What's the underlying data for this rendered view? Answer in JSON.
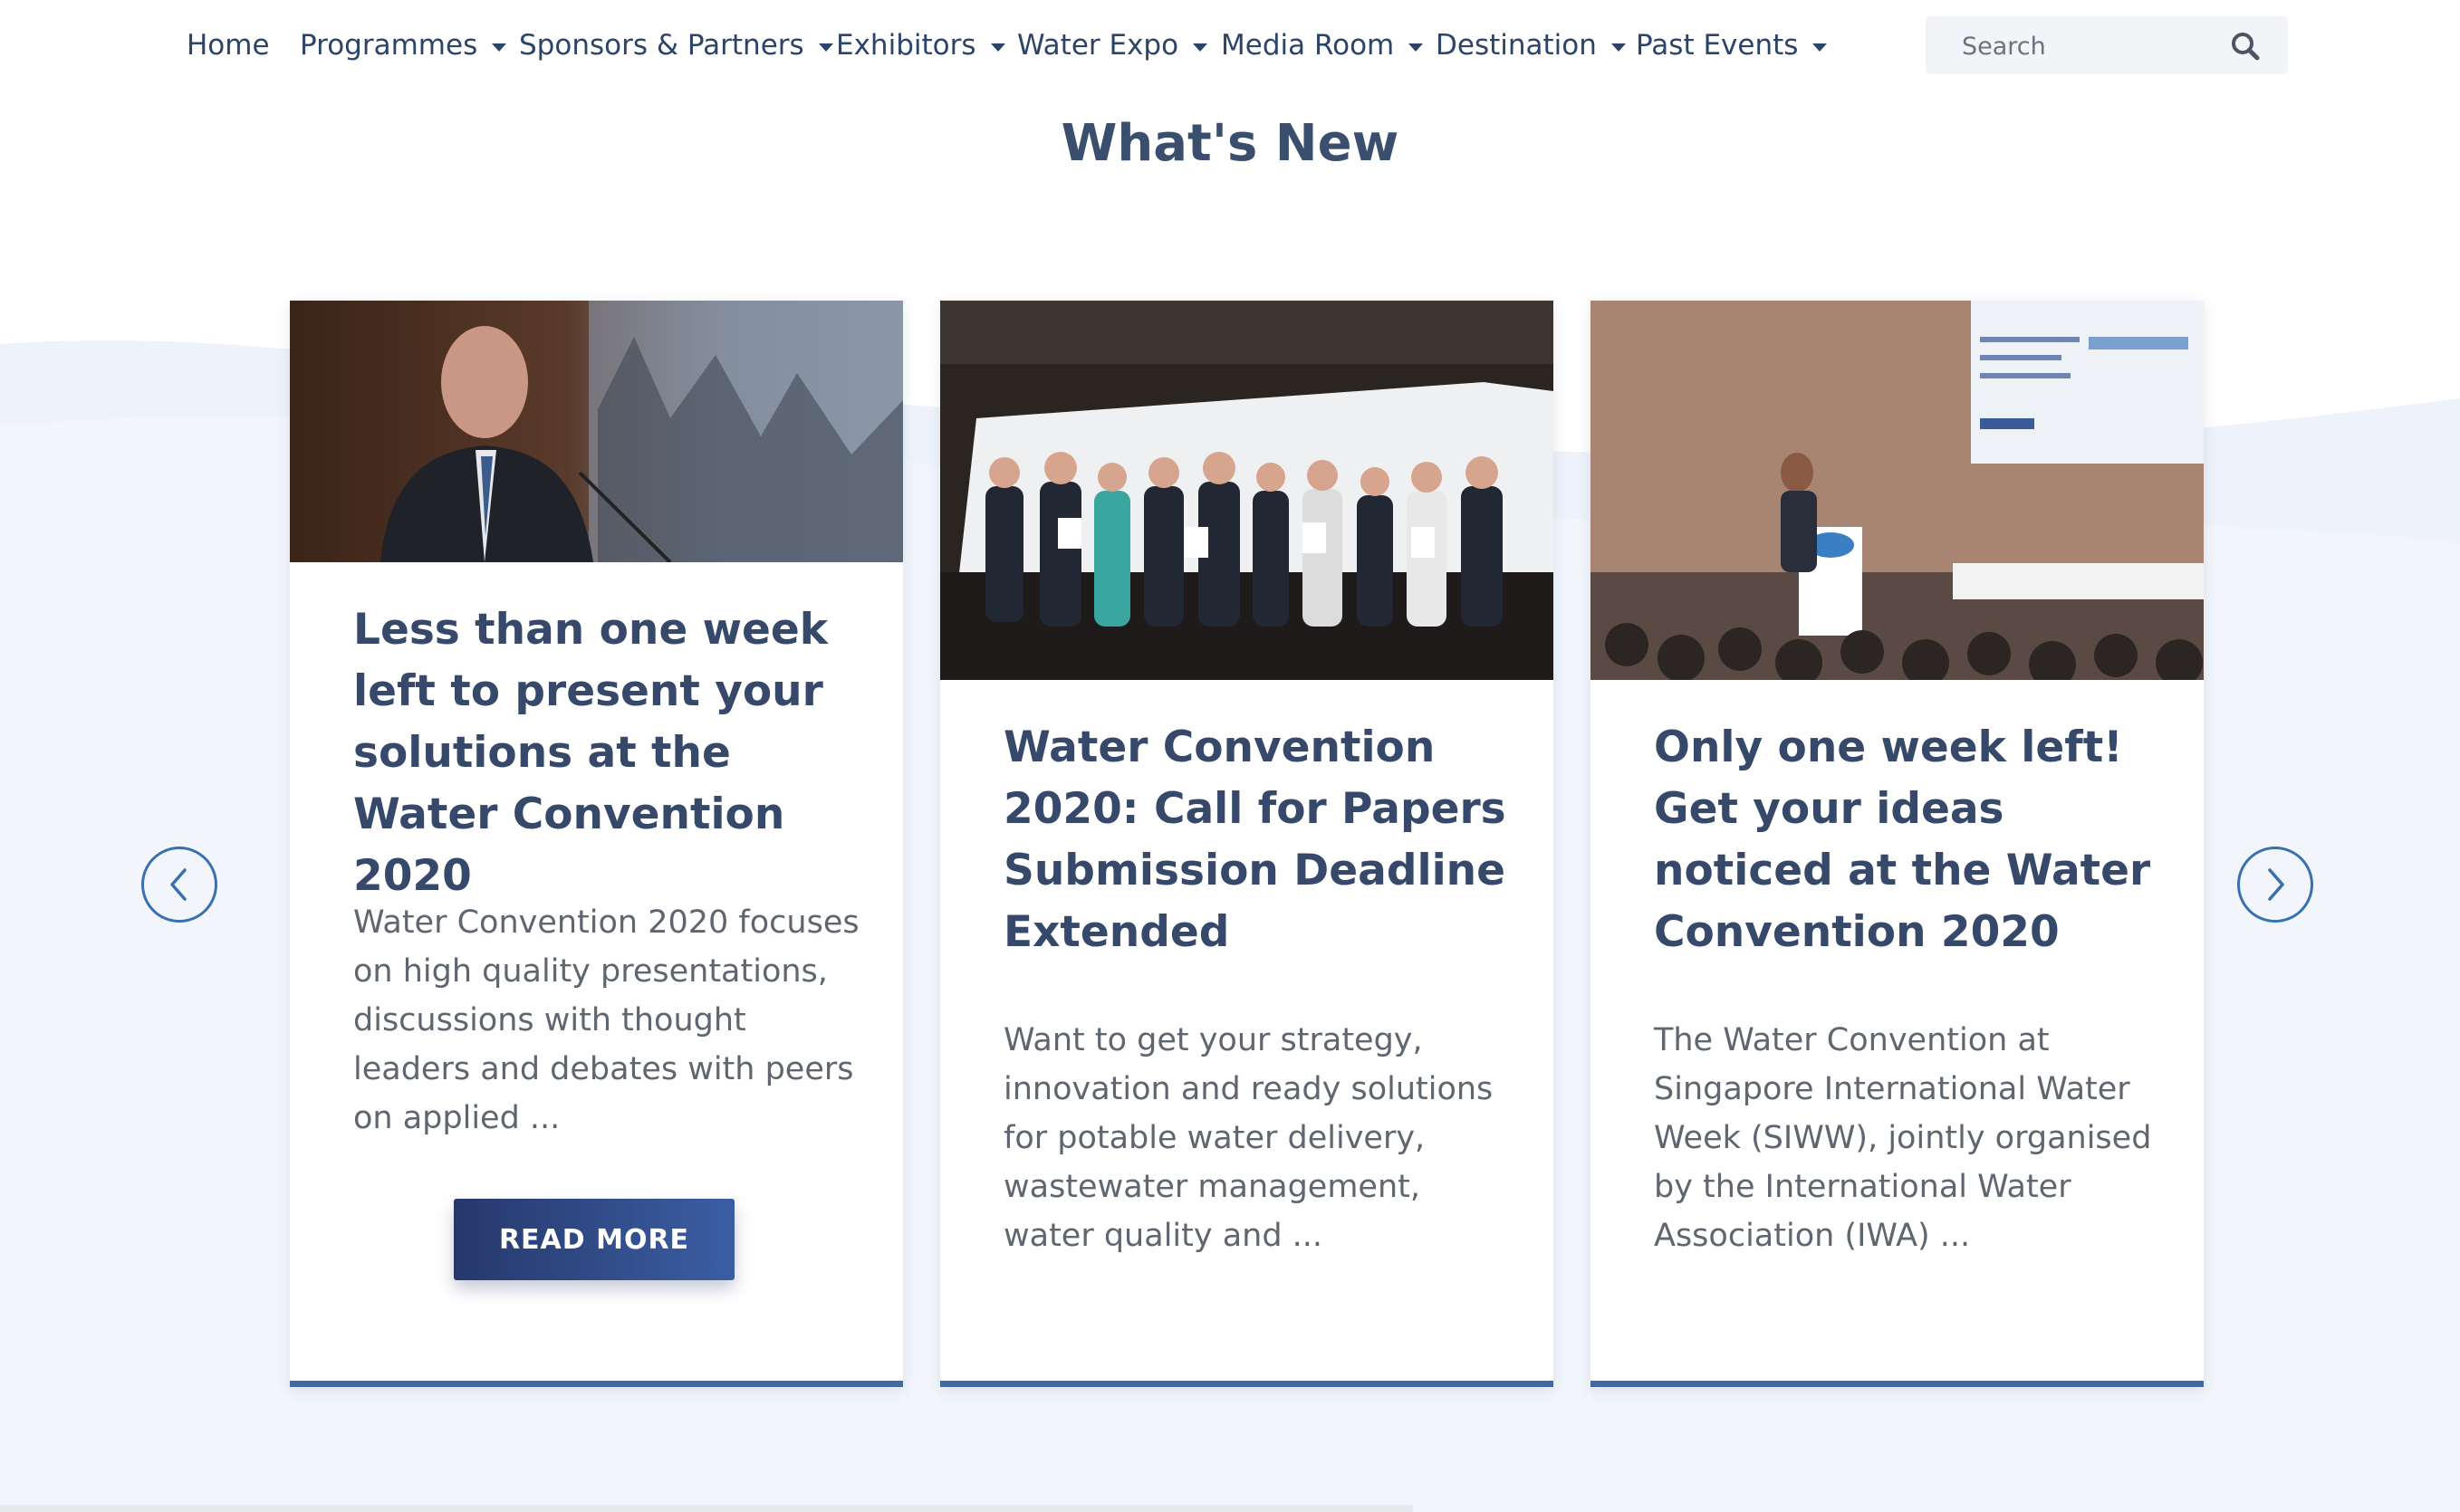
{
  "nav": {
    "items": [
      {
        "label": "Home",
        "has_dropdown": false
      },
      {
        "label": "Programmes",
        "has_dropdown": true
      },
      {
        "label": "Sponsors & Partners",
        "has_dropdown": true
      },
      {
        "label": "Exhibitors",
        "has_dropdown": true
      },
      {
        "label": "Water Expo",
        "has_dropdown": true
      },
      {
        "label": "Media Room",
        "has_dropdown": true
      },
      {
        "label": "Destination",
        "has_dropdown": true
      },
      {
        "label": "Past Events",
        "has_dropdown": true
      }
    ],
    "search": {
      "placeholder": "Search",
      "icon": "search-icon"
    }
  },
  "section": {
    "title": "What's New"
  },
  "carousel": {
    "prev_icon": "chevron-left-icon",
    "next_icon": "chevron-right-icon",
    "cards": [
      {
        "title": "Less than one week left to present your solutions at the Water Convention 2020",
        "excerpt": "Water Convention 2020 focuses on high quality presentations, discussions with thought leaders and debates with peers on applied ...",
        "button": "READ MORE"
      },
      {
        "title": "Water Convention 2020: Call for Papers Submission Deadline Extended",
        "excerpt": "Want to get your strategy, innovation and ready solutions for potable water delivery, wastewater management, water quality and ..."
      },
      {
        "title": "Only one week left! Get your ideas noticed at the Water Convention 2020",
        "excerpt": "The Water Convention at Singapore International Water Week (SIWW), jointly organised by the International Water Association (IWA) ..."
      }
    ]
  },
  "colors": {
    "nav_text": "#2c4467",
    "heading": "#3a4f6d",
    "card_bar": "#3f6aa6",
    "button_start": "#26386b",
    "button_end": "#3b5ea3",
    "arrow": "#3a6fb0",
    "page_wave": "#eef3fb"
  }
}
